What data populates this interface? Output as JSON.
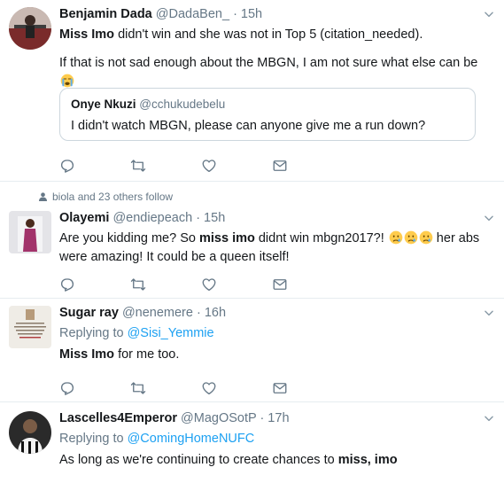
{
  "tweets": [
    {
      "name": "Benjamin Dada",
      "handle": "@DadaBen_",
      "time": "· 15h",
      "text_bold": "Miss Imo",
      "text_rest": " didn't win and she was not in Top 5 (citation_needed).",
      "text2": "If that is not sad enough about the MBGN, I am not sure what else can be",
      "quote": {
        "name": "Onye Nkuzi",
        "handle": "@cchukudebelu",
        "text": "I didn't watch MBGN, please can anyone give me a run down?"
      }
    },
    {
      "context": "biola and 23 others follow",
      "name": "Olayemi",
      "handle": "@endiepeach",
      "time": "· 15h",
      "text_a": "Are you kidding me? So ",
      "text_bold": "miss imo",
      "text_b": " didnt win mbgn2017?! ",
      "text_c": " her abs were amazing! It could be a queen itself!"
    },
    {
      "name": "Sugar ray",
      "handle": "@nenemere",
      "time": "· 16h",
      "replying_label": "Replying to",
      "replying_to": "@Sisi_Yemmie",
      "text_bold": "Miss Imo",
      "text_rest": " for me too."
    },
    {
      "name": "Lascelles4Emperor",
      "handle": "@MagOSotP",
      "time": "· 17h",
      "replying_label": "Replying to",
      "replying_to": "@ComingHomeNUFC",
      "text_a": "As long as we're continuing to create chances to ",
      "text_bold": "miss, imo"
    }
  ],
  "icons": [
    "reply-icon",
    "retweet-icon",
    "like-icon",
    "direct-message-icon",
    "chevron-down-icon",
    "crying-face-emoji",
    "loudly-crying-face-emoji",
    "person-icon"
  ],
  "colors": {
    "link": "#1da1f2",
    "meta": "#657786",
    "border": "#e6ecf0"
  }
}
